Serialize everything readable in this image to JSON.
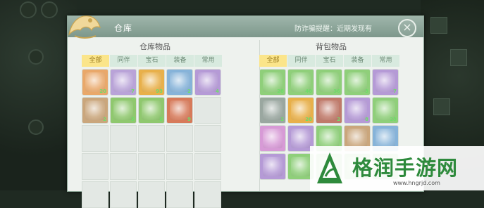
{
  "window": {
    "title": "仓库",
    "notice": "防诈骗提醒：近期发现有",
    "close_icon": "×"
  },
  "warehouse": {
    "heading": "仓库物品",
    "tabs": [
      "全部",
      "同伴",
      "宝石",
      "装备",
      "常用"
    ],
    "active_tab": 0,
    "items": [
      {
        "icon": "gold-medallion-icon",
        "color": "#e9a86a",
        "count": "20"
      },
      {
        "icon": "blue-vase-icon",
        "color": "#b9a3d8",
        "count": "7"
      },
      {
        "icon": "gold-bag-icon",
        "color": "#e8b04a",
        "count": "93"
      },
      {
        "icon": "blue-book-icon",
        "color": "#86b3d9",
        "count": "2"
      },
      {
        "icon": "red-potion-icon",
        "color": "#b59ad6",
        "count": "4"
      },
      {
        "icon": "scroll-icon",
        "color": "#caa67c",
        "count": "2"
      },
      {
        "icon": "jade-ring-icon",
        "color": "#8fc86e",
        "count": "5"
      },
      {
        "icon": "jade-ring-icon",
        "color": "#8fc86e",
        "count": "5"
      },
      {
        "icon": "red-armor-icon",
        "color": "#d77a5a",
        "count": "9"
      }
    ],
    "empty_cells": 16
  },
  "bag": {
    "heading": "背包物品",
    "tabs": [
      "全部",
      "同伴",
      "宝石",
      "装备",
      "常用"
    ],
    "active_tab": 0,
    "items": [
      {
        "icon": "herb-plant-icon",
        "color": "#8fcf7a",
        "count": "28"
      },
      {
        "icon": "herb-plant-icon",
        "color": "#8fcf7a",
        "count": "40"
      },
      {
        "icon": "blue-vase-icon",
        "color": "#8fcf7a",
        "count": "36"
      },
      {
        "icon": "green-book-icon",
        "color": "#8fcf7a",
        "count": "3"
      },
      {
        "icon": "sword-scroll-icon",
        "color": "#b59ad6",
        "count": "7"
      },
      {
        "icon": "treasure-chest-icon",
        "color": "#9aa7a0",
        "count": "2"
      },
      {
        "icon": "gold-ticket-icon",
        "color": "#e8b04a",
        "count": "20"
      },
      {
        "icon": "red-book-icon",
        "color": "#c07a6a",
        "count": "2"
      },
      {
        "icon": "brush-icon",
        "color": "#b59ad6",
        "count": "8"
      },
      {
        "icon": "jade-bowl-icon",
        "color": "#8fcf7a",
        "count": "23"
      },
      {
        "icon": "pink-potion-icon",
        "color": "#d79ad6",
        "count": ""
      },
      {
        "icon": "purple-gem-icon",
        "color": "#b59ad6",
        "count": ""
      },
      {
        "icon": "crystal-icon",
        "color": "#8fcf7a",
        "count": ""
      },
      {
        "icon": "open-book-icon",
        "color": "#caa67c",
        "count": ""
      },
      {
        "icon": "blue-crystal-icon",
        "color": "#86b3d9",
        "count": ""
      },
      {
        "icon": "blue-crystal-icon",
        "color": "#b59ad6",
        "count": ""
      },
      {
        "icon": "blue-crystal-icon",
        "color": "#8fcf7a",
        "count": ""
      },
      {
        "icon": "green-gem-icon",
        "color": "#8fcf7a",
        "count": ""
      },
      {
        "icon": "green-gem-icon",
        "color": "#8fcf7a",
        "count": ""
      },
      {
        "icon": "green-gem-icon",
        "color": "#8fcf7a",
        "count": ""
      }
    ]
  },
  "watermark": {
    "name": "格润手游网",
    "url": "www.hngrjd.com"
  },
  "colors": {
    "tab_active": "#fbe58a",
    "tab_inactive": "#d8eadf",
    "titlebar": "#8aa79a",
    "count_text": "#6fdc6a"
  }
}
